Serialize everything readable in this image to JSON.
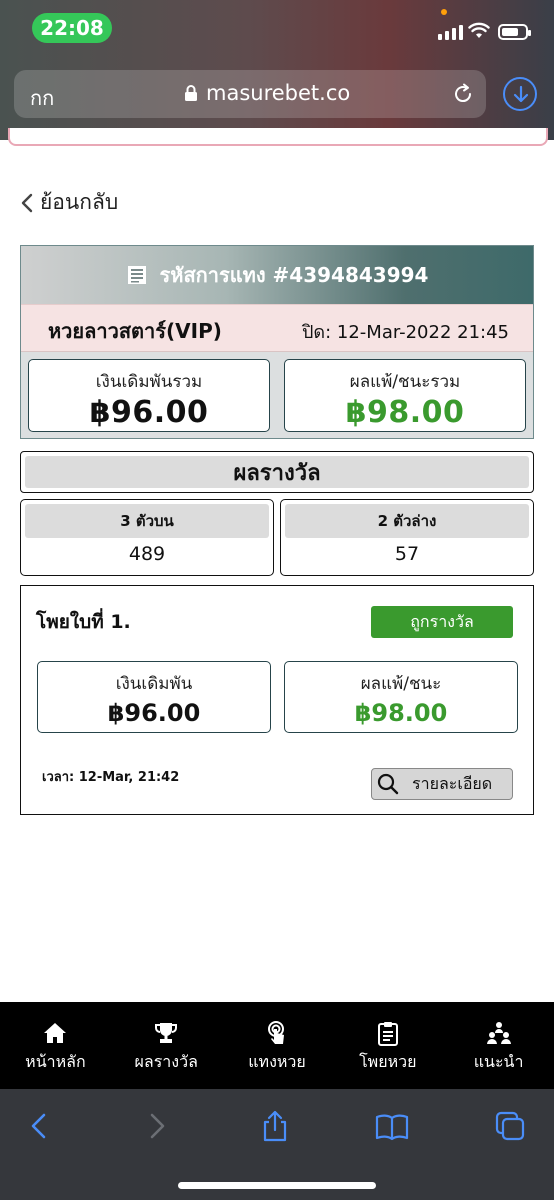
{
  "browser": {
    "time": "22:08",
    "text_size_label": "กก",
    "url": "masurebet.co"
  },
  "page": {
    "back_label": "ย้อนกลับ"
  },
  "summary": {
    "bet_code_label": "รหัสการแทง #4394843994",
    "lotto_name": "หวยลาวสตาร์(VIP)",
    "close_time": "ปิด: 12-Mar-2022 21:45",
    "total_bet_label": "เงินเดิมพันรวม",
    "total_bet_value": "฿96.00",
    "total_result_label": "ผลแพ้/ชนะรวม",
    "total_result_value": "฿98.00"
  },
  "results": {
    "title": "ผลรางวัล",
    "items": [
      {
        "label": "3 ตัวบน",
        "value": "489"
      },
      {
        "label": "2 ตัวล่าง",
        "value": "57"
      }
    ]
  },
  "ticket": {
    "title": "โพยใบที่ 1.",
    "status_badge": "ถูกรางวัล",
    "bet_label": "เงินเดิมพัน",
    "bet_value": "฿96.00",
    "result_label": "ผลแพ้/ชนะ",
    "result_value": "฿98.00",
    "time": "เวลา: 12-Mar, 21:42",
    "detail_button": "รายละเอียด"
  },
  "nav": {
    "items": [
      {
        "label": "หน้าหลัก",
        "icon": "home-icon"
      },
      {
        "label": "ผลรางวัล",
        "icon": "trophy-icon"
      },
      {
        "label": "แทงหวย",
        "icon": "tap-icon"
      },
      {
        "label": "โพยหวย",
        "icon": "clipboard-icon"
      },
      {
        "label": "แนะนำ",
        "icon": "people-icon"
      }
    ]
  },
  "colors": {
    "win_green": "#3a9a2e",
    "safari_blue": "#4a8df8"
  }
}
